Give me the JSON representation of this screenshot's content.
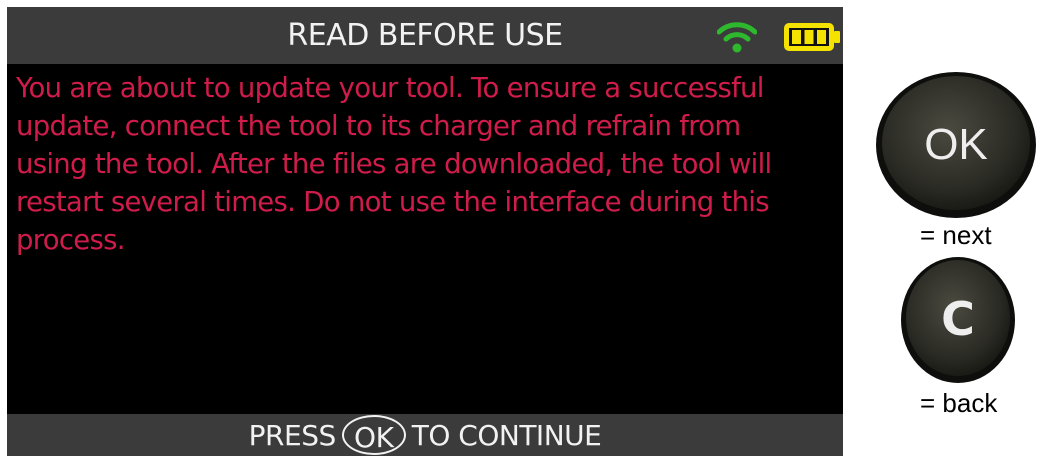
{
  "header": {
    "title": "READ BEFORE USE",
    "wifi_icon": "wifi-icon",
    "battery_icon": "battery-icon",
    "wifi_color": "#2eb82e"
  },
  "message": {
    "text": "You are about to update your tool. To ensure a successful update, connect the tool to its charger and refrain from using the tool. After the files are downloaded, the tool will restart several times. Do not use the interface during this process.",
    "color": "#d01c4a"
  },
  "footer": {
    "prefix": "PRESS",
    "ok_label": "OK",
    "suffix": "TO CONTINUE"
  },
  "legend": {
    "ok_button_label": "OK",
    "ok_meaning": "= next",
    "c_button_label": "C",
    "c_meaning": "= back"
  }
}
